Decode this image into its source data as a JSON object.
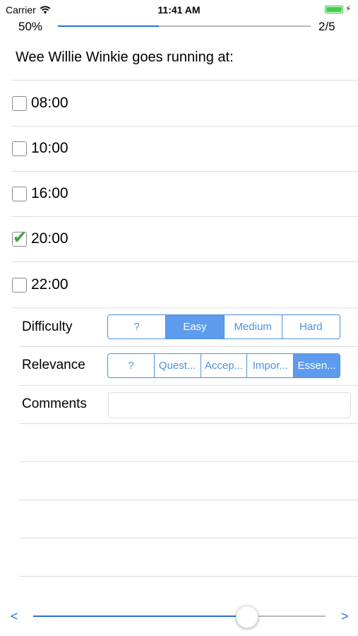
{
  "status_bar": {
    "carrier": "Carrier",
    "time": "11:41 AM"
  },
  "progress": {
    "percent_label": "50%",
    "fraction": 0.4,
    "page_label": "2/5"
  },
  "question": "Wee Willie Winkie goes running at:",
  "choices": [
    {
      "label": "08:00",
      "checked": false
    },
    {
      "label": "10:00",
      "checked": false
    },
    {
      "label": "16:00",
      "checked": false
    },
    {
      "label": "20:00",
      "checked": true
    },
    {
      "label": "22:00",
      "checked": false
    }
  ],
  "difficulty": {
    "label": "Difficulty",
    "options": [
      "?",
      "Easy",
      "Medium",
      "Hard"
    ],
    "selected_index": 1
  },
  "relevance": {
    "label": "Relevance",
    "options": [
      "?",
      "Quest...",
      "Accep...",
      "Impor...",
      "Essen..."
    ],
    "selected_index": 4
  },
  "comments": {
    "label": "Comments",
    "value": ""
  },
  "navigation": {
    "prev": "<",
    "next": ">",
    "slider_value": 0.73
  },
  "colors": {
    "accent": "#2f6fd6",
    "segment_selected": "#5d9cec",
    "check": "#3aa23a",
    "battery": "#3cd24a"
  }
}
